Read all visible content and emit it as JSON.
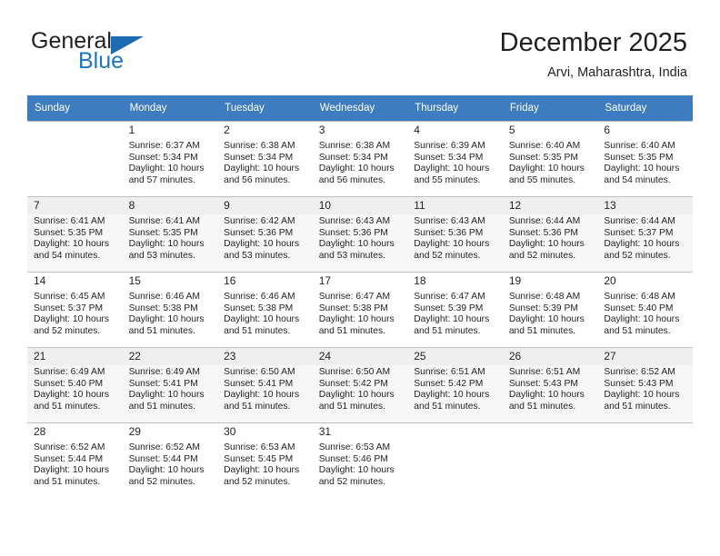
{
  "brand": {
    "name_part1": "General",
    "name_part2": "Blue",
    "triangle_color": "#1b6cb0"
  },
  "header": {
    "title": "December 2025",
    "location": "Arvi, Maharashtra, India"
  },
  "calendar": {
    "header_bg": "#3d7cbf",
    "weekdays": [
      "Sunday",
      "Monday",
      "Tuesday",
      "Wednesday",
      "Thursday",
      "Friday",
      "Saturday"
    ],
    "weeks": [
      [
        {
          "day": "",
          "info": ""
        },
        {
          "day": "1",
          "info": "Sunrise: 6:37 AM\nSunset: 5:34 PM\nDaylight: 10 hours\nand 57 minutes."
        },
        {
          "day": "2",
          "info": "Sunrise: 6:38 AM\nSunset: 5:34 PM\nDaylight: 10 hours\nand 56 minutes."
        },
        {
          "day": "3",
          "info": "Sunrise: 6:38 AM\nSunset: 5:34 PM\nDaylight: 10 hours\nand 56 minutes."
        },
        {
          "day": "4",
          "info": "Sunrise: 6:39 AM\nSunset: 5:34 PM\nDaylight: 10 hours\nand 55 minutes."
        },
        {
          "day": "5",
          "info": "Sunrise: 6:40 AM\nSunset: 5:35 PM\nDaylight: 10 hours\nand 55 minutes."
        },
        {
          "day": "6",
          "info": "Sunrise: 6:40 AM\nSunset: 5:35 PM\nDaylight: 10 hours\nand 54 minutes."
        }
      ],
      [
        {
          "day": "7",
          "info": "Sunrise: 6:41 AM\nSunset: 5:35 PM\nDaylight: 10 hours\nand 54 minutes."
        },
        {
          "day": "8",
          "info": "Sunrise: 6:41 AM\nSunset: 5:35 PM\nDaylight: 10 hours\nand 53 minutes."
        },
        {
          "day": "9",
          "info": "Sunrise: 6:42 AM\nSunset: 5:36 PM\nDaylight: 10 hours\nand 53 minutes."
        },
        {
          "day": "10",
          "info": "Sunrise: 6:43 AM\nSunset: 5:36 PM\nDaylight: 10 hours\nand 53 minutes."
        },
        {
          "day": "11",
          "info": "Sunrise: 6:43 AM\nSunset: 5:36 PM\nDaylight: 10 hours\nand 52 minutes."
        },
        {
          "day": "12",
          "info": "Sunrise: 6:44 AM\nSunset: 5:36 PM\nDaylight: 10 hours\nand 52 minutes."
        },
        {
          "day": "13",
          "info": "Sunrise: 6:44 AM\nSunset: 5:37 PM\nDaylight: 10 hours\nand 52 minutes."
        }
      ],
      [
        {
          "day": "14",
          "info": "Sunrise: 6:45 AM\nSunset: 5:37 PM\nDaylight: 10 hours\nand 52 minutes."
        },
        {
          "day": "15",
          "info": "Sunrise: 6:46 AM\nSunset: 5:38 PM\nDaylight: 10 hours\nand 51 minutes."
        },
        {
          "day": "16",
          "info": "Sunrise: 6:46 AM\nSunset: 5:38 PM\nDaylight: 10 hours\nand 51 minutes."
        },
        {
          "day": "17",
          "info": "Sunrise: 6:47 AM\nSunset: 5:38 PM\nDaylight: 10 hours\nand 51 minutes."
        },
        {
          "day": "18",
          "info": "Sunrise: 6:47 AM\nSunset: 5:39 PM\nDaylight: 10 hours\nand 51 minutes."
        },
        {
          "day": "19",
          "info": "Sunrise: 6:48 AM\nSunset: 5:39 PM\nDaylight: 10 hours\nand 51 minutes."
        },
        {
          "day": "20",
          "info": "Sunrise: 6:48 AM\nSunset: 5:40 PM\nDaylight: 10 hours\nand 51 minutes."
        }
      ],
      [
        {
          "day": "21",
          "info": "Sunrise: 6:49 AM\nSunset: 5:40 PM\nDaylight: 10 hours\nand 51 minutes."
        },
        {
          "day": "22",
          "info": "Sunrise: 6:49 AM\nSunset: 5:41 PM\nDaylight: 10 hours\nand 51 minutes."
        },
        {
          "day": "23",
          "info": "Sunrise: 6:50 AM\nSunset: 5:41 PM\nDaylight: 10 hours\nand 51 minutes."
        },
        {
          "day": "24",
          "info": "Sunrise: 6:50 AM\nSunset: 5:42 PM\nDaylight: 10 hours\nand 51 minutes."
        },
        {
          "day": "25",
          "info": "Sunrise: 6:51 AM\nSunset: 5:42 PM\nDaylight: 10 hours\nand 51 minutes."
        },
        {
          "day": "26",
          "info": "Sunrise: 6:51 AM\nSunset: 5:43 PM\nDaylight: 10 hours\nand 51 minutes."
        },
        {
          "day": "27",
          "info": "Sunrise: 6:52 AM\nSunset: 5:43 PM\nDaylight: 10 hours\nand 51 minutes."
        }
      ],
      [
        {
          "day": "28",
          "info": "Sunrise: 6:52 AM\nSunset: 5:44 PM\nDaylight: 10 hours\nand 51 minutes."
        },
        {
          "day": "29",
          "info": "Sunrise: 6:52 AM\nSunset: 5:44 PM\nDaylight: 10 hours\nand 52 minutes."
        },
        {
          "day": "30",
          "info": "Sunrise: 6:53 AM\nSunset: 5:45 PM\nDaylight: 10 hours\nand 52 minutes."
        },
        {
          "day": "31",
          "info": "Sunrise: 6:53 AM\nSunset: 5:46 PM\nDaylight: 10 hours\nand 52 minutes."
        },
        {
          "day": "",
          "info": ""
        },
        {
          "day": "",
          "info": ""
        },
        {
          "day": "",
          "info": ""
        }
      ]
    ]
  }
}
